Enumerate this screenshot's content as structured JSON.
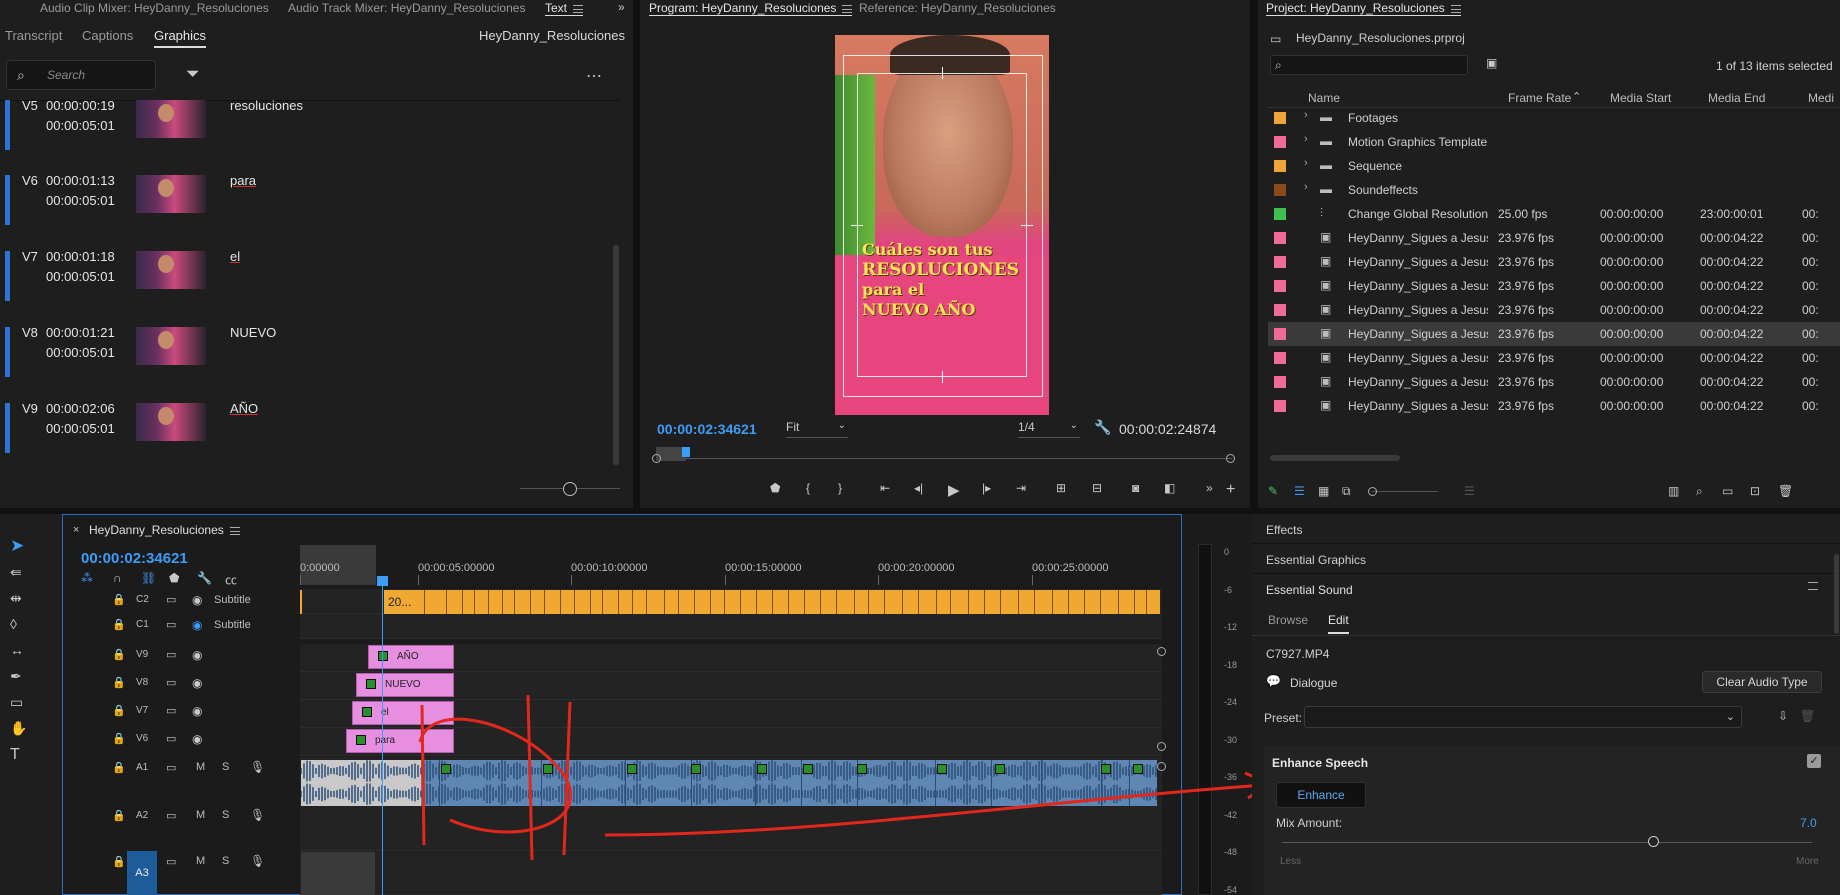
{
  "graphics_panel": {
    "tabs_top": [
      "Audio Clip Mixer: HeyDanny_Resoluciones",
      "Audio Track Mixer: HeyDanny_Resoluciones",
      "Text"
    ],
    "subtabs": [
      "Transcript",
      "Captions",
      "Graphics"
    ],
    "sequence_name": "HeyDanny_Resoluciones",
    "search_placeholder": "Search",
    "rows": [
      {
        "track": "V5",
        "in": "00:00:00:19",
        "dur": "00:00:05:01",
        "word": "resoluciones"
      },
      {
        "track": "V6",
        "in": "00:00:01:13",
        "dur": "00:00:05:01",
        "word": "para"
      },
      {
        "track": "V7",
        "in": "00:00:01:18",
        "dur": "00:00:05:01",
        "word": "el"
      },
      {
        "track": "V8",
        "in": "00:00:01:21",
        "dur": "00:00:05:01",
        "word": "NUEVO"
      },
      {
        "track": "V9",
        "in": "00:00:02:06",
        "dur": "00:00:05:01",
        "word": "AÑO"
      }
    ]
  },
  "program_monitor": {
    "tabs": [
      "Program: HeyDanny_Resoluciones",
      "Reference: HeyDanny_Resoluciones"
    ],
    "caption_lines": [
      "Cuáles son tus",
      "RESOLUCIONES",
      "para el",
      "NUEVO AÑO"
    ],
    "timecode": "00:00:02:34621",
    "fit": "Fit",
    "resolution": "1/4",
    "duration": "00:00:02:24874"
  },
  "project_panel": {
    "title": "Project: HeyDanny_Resoluciones",
    "file": "HeyDanny_Resoluciones.prproj",
    "count": "1 of 13 items selected",
    "columns": [
      "Name",
      "Frame Rate",
      "Media Start",
      "Media End",
      "Medi"
    ],
    "rows": [
      {
        "color": "#f0a33a",
        "name": "Footages",
        "fr": "",
        "ms": "",
        "me": "",
        "mx": ""
      },
      {
        "color": "#f06a9a",
        "name": "Motion Graphics Template",
        "fr": "",
        "ms": "",
        "me": "",
        "mx": ""
      },
      {
        "color": "#f0a33a",
        "name": "Sequence",
        "fr": "",
        "ms": "",
        "me": "",
        "mx": ""
      },
      {
        "color": "#8a4a1c",
        "name": "Soundeffects",
        "fr": "",
        "ms": "",
        "me": "",
        "mx": ""
      },
      {
        "color": "#3fbf4f",
        "name": "Change Global Resolutions",
        "fr": "25.00 fps",
        "ms": "00:00:00:00",
        "me": "23:00:00:01",
        "mx": "00:"
      },
      {
        "color": "#f06a9a",
        "name": "HeyDanny_Sigues a Jesus de",
        "fr": "23.976 fps",
        "ms": "00:00:00:00",
        "me": "00:00:04:22",
        "mx": "00:"
      },
      {
        "color": "#f06a9a",
        "name": "HeyDanny_Sigues a Jesus de",
        "fr": "23.976 fps",
        "ms": "00:00:00:00",
        "me": "00:00:04:22",
        "mx": "00:"
      },
      {
        "color": "#f06a9a",
        "name": "HeyDanny_Sigues a Jesus de",
        "fr": "23.976 fps",
        "ms": "00:00:00:00",
        "me": "00:00:04:22",
        "mx": "00:"
      },
      {
        "color": "#f06a9a",
        "name": "HeyDanny_Sigues a Jesus de",
        "fr": "23.976 fps",
        "ms": "00:00:00:00",
        "me": "00:00:04:22",
        "mx": "00:"
      },
      {
        "color": "#f06a9a",
        "name": "HeyDanny_Sigues a Jesus de",
        "fr": "23.976 fps",
        "ms": "00:00:00:00",
        "me": "00:00:04:22",
        "mx": "00:"
      },
      {
        "color": "#f06a9a",
        "name": "HeyDanny_Sigues a Jesus de",
        "fr": "23.976 fps",
        "ms": "00:00:00:00",
        "me": "00:00:04:22",
        "mx": "00:"
      },
      {
        "color": "#f06a9a",
        "name": "HeyDanny_Sigues a Jesus de",
        "fr": "23.976 fps",
        "ms": "00:00:00:00",
        "me": "00:00:04:22",
        "mx": "00:"
      },
      {
        "color": "#f06a9a",
        "name": "HeyDanny_Sigues a Jesus de",
        "fr": "23.976 fps",
        "ms": "00:00:00:00",
        "me": "00:00:04:22",
        "mx": "00:"
      }
    ]
  },
  "timeline": {
    "title": "HeyDanny_Resoluciones",
    "timecode": "00:00:02:34621",
    "ruler": [
      "0:00000",
      "00:00:05:00000",
      "00:00:10:00000",
      "00:00:15:00000",
      "00:00:20:00000",
      "00:00:25:00000"
    ],
    "tracks": [
      {
        "id": "C2",
        "label": "Subtitle"
      },
      {
        "id": "C1",
        "label": "Subtitle"
      },
      {
        "id": "V9",
        "label": ""
      },
      {
        "id": "V8",
        "label": ""
      },
      {
        "id": "V7",
        "label": ""
      },
      {
        "id": "V6",
        "label": ""
      },
      {
        "id": "A1",
        "label": ""
      },
      {
        "id": "A2",
        "label": ""
      },
      {
        "id": "A3",
        "label": ""
      }
    ],
    "subtitle_clip": "20...",
    "clips": [
      "AÑO",
      "NUEVO",
      "el",
      "para"
    ],
    "meter_scale": [
      "0",
      "-6",
      "-12",
      "-18",
      "-24",
      "-30",
      "-36",
      "-42",
      "-48",
      "-54"
    ]
  },
  "essential_sound": {
    "sections": [
      "Effects",
      "Essential Graphics",
      "Essential Sound"
    ],
    "tabs": [
      "Browse",
      "Edit"
    ],
    "clip": "C7927.MP4",
    "type": "Dialogue",
    "clear_button": "Clear Audio Type",
    "preset_label": "Preset:",
    "enhance_title": "Enhance Speech",
    "enhance_button": "Enhance",
    "mix_label": "Mix Amount:",
    "mix_value": "7.0",
    "mix_fraction": 0.7,
    "less": "Less",
    "more": "More"
  }
}
